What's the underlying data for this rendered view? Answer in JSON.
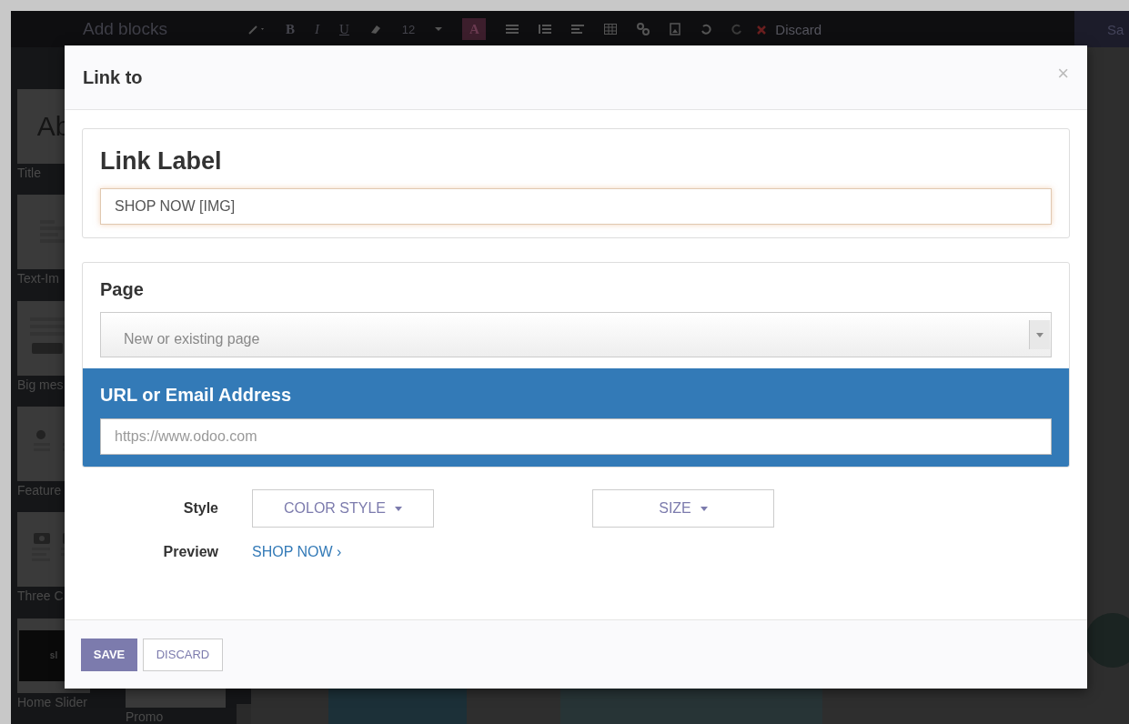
{
  "editor": {
    "title": "Add blocks",
    "toolbar": {
      "bold": "B",
      "italic": "I",
      "underline": "U",
      "font_size": "12",
      "font_color": "A",
      "discard": "Discard",
      "save": "Sa"
    },
    "blocks": [
      {
        "label": "Title",
        "kind": "title",
        "thumb_text": "Ab"
      },
      {
        "label": "Text-Im",
        "kind": "text"
      },
      {
        "label": "Big mes",
        "kind": "big"
      },
      {
        "label": "Feature",
        "kind": "features"
      },
      {
        "label": "Three C",
        "kind": "columns"
      },
      {
        "label": "Home Slider",
        "kind": "slider",
        "thumb_text": "sl"
      }
    ],
    "extra_block": {
      "label": "Promo"
    }
  },
  "dialog": {
    "title": "Link to",
    "close": "×",
    "link_label": {
      "heading": "Link Label",
      "value": "SHOP NOW [IMG]"
    },
    "page": {
      "heading": "Page",
      "placeholder": "New or existing page"
    },
    "url": {
      "heading": "URL or Email Address",
      "placeholder": "https://www.odoo.com",
      "selected": true
    },
    "style": {
      "label": "Style",
      "color_style": "COLOR STYLE",
      "size": "SIZE"
    },
    "preview": {
      "label": "Preview",
      "link": "SHOP NOW ›"
    },
    "buttons": {
      "save": "SAVE",
      "discard": "DISCARD"
    }
  }
}
